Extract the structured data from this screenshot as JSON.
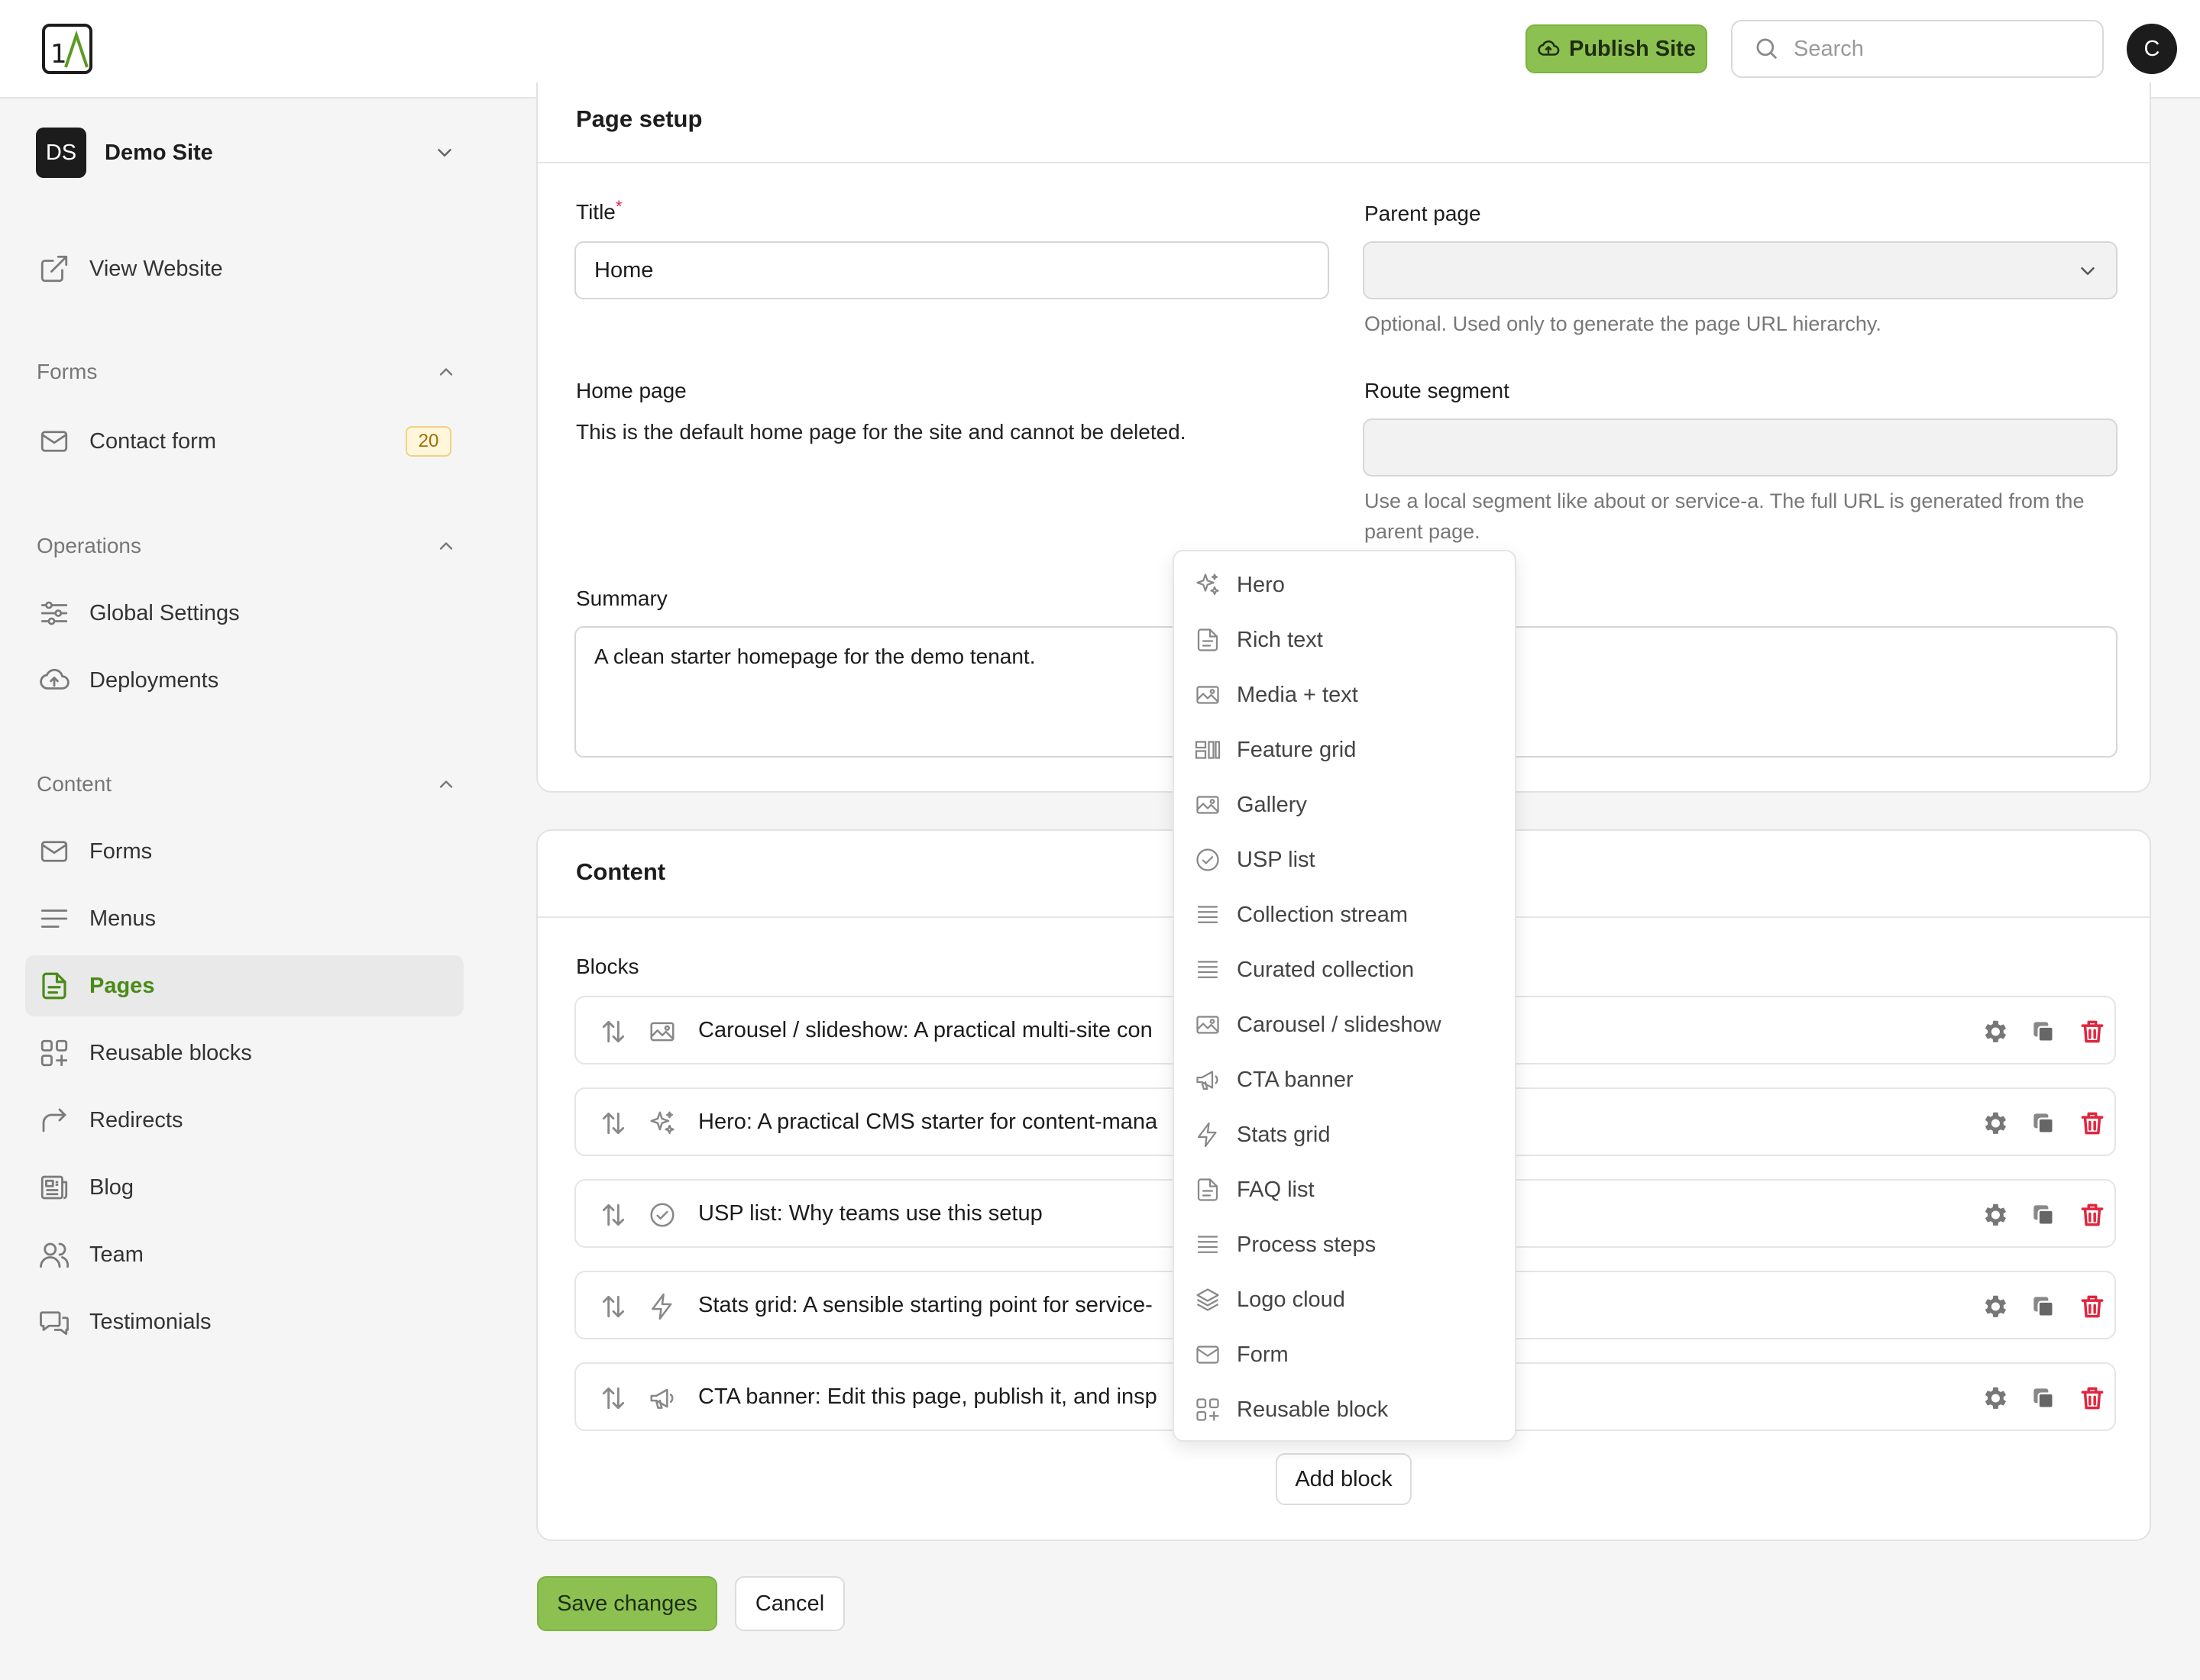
{
  "header": {
    "publish_label": "Publish Site",
    "search_placeholder": "Search",
    "avatar_initial": "C"
  },
  "sidebar": {
    "site": {
      "initials": "DS",
      "name": "Demo Site"
    },
    "view_website": "View Website",
    "sections": {
      "forms": {
        "title": "Forms",
        "items": [
          {
            "label": "Contact form",
            "count": "20",
            "icon": "mail-icon"
          }
        ]
      },
      "operations": {
        "title": "Operations",
        "items": [
          {
            "label": "Global Settings",
            "icon": "sliders-icon"
          },
          {
            "label": "Deployments",
            "icon": "cloud-upload-icon"
          }
        ]
      },
      "content": {
        "title": "Content",
        "items": [
          {
            "label": "Forms",
            "icon": "mail-icon"
          },
          {
            "label": "Menus",
            "icon": "menu-lines-icon"
          },
          {
            "label": "Pages",
            "icon": "document-icon",
            "active": true
          },
          {
            "label": "Reusable blocks",
            "icon": "blocks-icon"
          },
          {
            "label": "Redirects",
            "icon": "redirect-arrow-icon"
          },
          {
            "label": "Blog",
            "icon": "newspaper-icon"
          },
          {
            "label": "Team",
            "icon": "users-icon"
          },
          {
            "label": "Testimonials",
            "icon": "chat-bubbles-icon"
          }
        ]
      }
    }
  },
  "page_setup": {
    "title": "Page setup",
    "title_field": {
      "label": "Title",
      "required_mark": "*",
      "value": "Home"
    },
    "parent_page": {
      "label": "Parent page",
      "value": "",
      "help": "Optional. Used only to generate the page URL hierarchy."
    },
    "home_page": {
      "label": "Home page",
      "text": "This is the default home page for the site and cannot be deleted."
    },
    "route_segment": {
      "label": "Route segment",
      "value": "",
      "help": "Use a local segment like about or service-a. The full URL is generated from the parent page."
    },
    "summary": {
      "label": "Summary",
      "value": "A clean starter homepage for the demo tenant."
    }
  },
  "content": {
    "title": "Content",
    "blocks_label": "Blocks",
    "blocks": [
      {
        "title": "Carousel / slideshow: A practical multi-site con",
        "icon": "image-icon"
      },
      {
        "title": "Hero: A practical CMS starter for content-mana",
        "icon": "sparkles-icon"
      },
      {
        "title": "USP list: Why teams use this setup",
        "icon": "check-circle-icon"
      },
      {
        "title": "Stats grid: A sensible starting point for service-",
        "icon": "lightning-icon"
      },
      {
        "title": "CTA banner: Edit this page, publish it, and insp",
        "icon": "megaphone-icon"
      }
    ],
    "add_block_label": "Add block"
  },
  "block_menu": {
    "items": [
      {
        "label": "Hero",
        "icon": "sparkles-icon"
      },
      {
        "label": "Rich text",
        "icon": "document-icon"
      },
      {
        "label": "Media + text",
        "icon": "image-icon"
      },
      {
        "label": "Feature grid",
        "icon": "grid-layout-icon"
      },
      {
        "label": "Gallery",
        "icon": "image-icon"
      },
      {
        "label": "USP list",
        "icon": "check-circle-icon"
      },
      {
        "label": "Collection stream",
        "icon": "list-lines-icon"
      },
      {
        "label": "Curated collection",
        "icon": "list-lines-icon"
      },
      {
        "label": "Carousel / slideshow",
        "icon": "image-icon"
      },
      {
        "label": "CTA banner",
        "icon": "megaphone-icon"
      },
      {
        "label": "Stats grid",
        "icon": "lightning-icon"
      },
      {
        "label": "FAQ list",
        "icon": "document-icon"
      },
      {
        "label": "Process steps",
        "icon": "list-lines-icon"
      },
      {
        "label": "Logo cloud",
        "icon": "layers-icon"
      },
      {
        "label": "Form",
        "icon": "mail-icon"
      },
      {
        "label": "Reusable block",
        "icon": "blocks-icon"
      }
    ]
  },
  "footer": {
    "save_label": "Save changes",
    "cancel_label": "Cancel"
  },
  "colors": {
    "accent": "#8cc152",
    "active_nav_text": "#4a8a16",
    "danger": "#e0263e"
  }
}
